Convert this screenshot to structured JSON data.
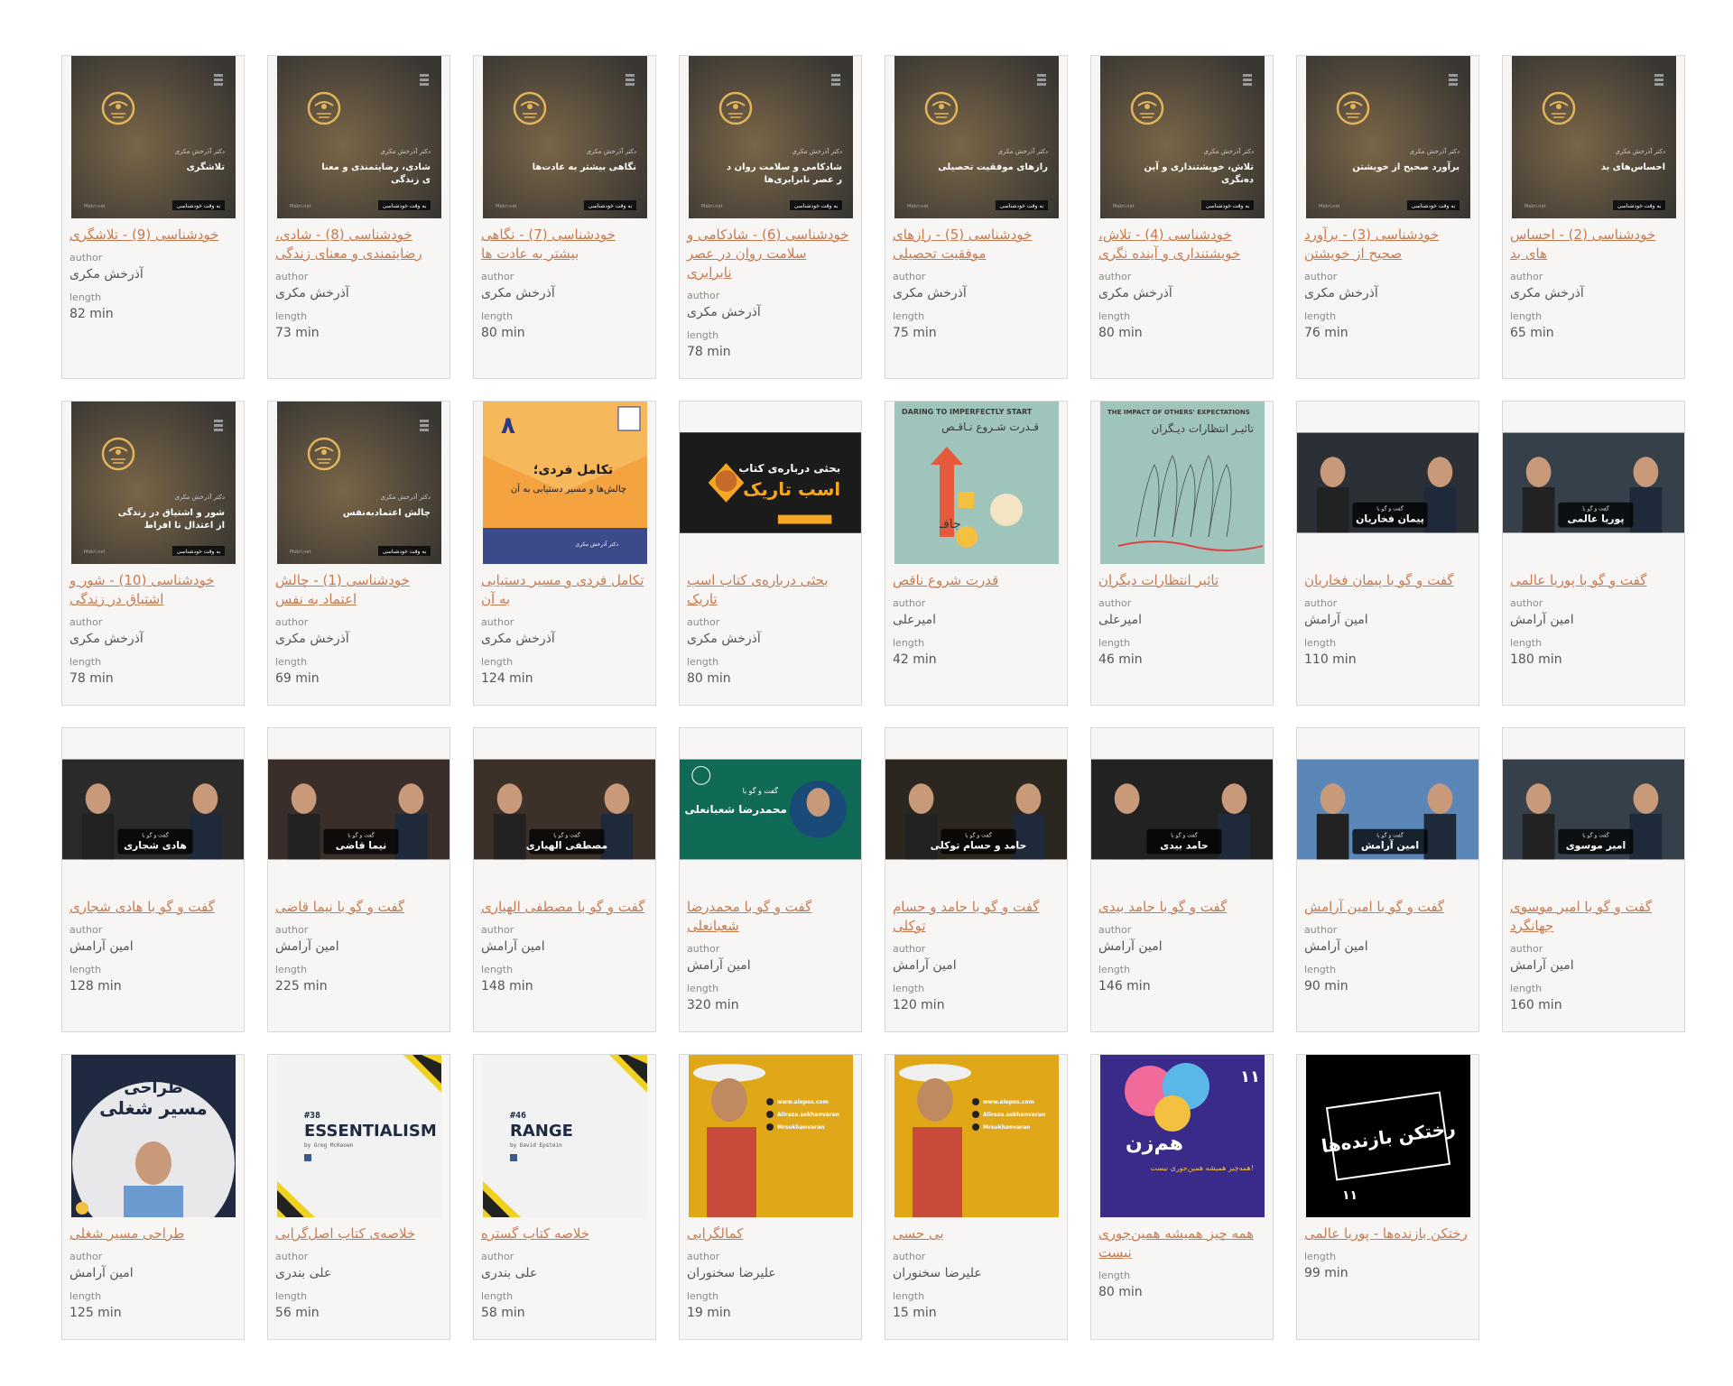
{
  "labels": {
    "author": "author",
    "length": "length"
  },
  "cards": [
    {
      "title": "خودشناسی (9) - تلاشگری",
      "author": "آذرخش مکری",
      "length": "82 min",
      "thumb": {
        "kind": "poster",
        "text": "تلاشگری"
      }
    },
    {
      "title": "خودشناسی (8) - شادی، رضایتمندی و معنای زندگی",
      "author": "آذرخش مکری",
      "length": "73 min",
      "thumb": {
        "kind": "poster",
        "text": "شادی، رضایتمندی و معنای زندگی"
      }
    },
    {
      "title": "خودشناسی (7) - نگاهی بیشتر به عادت ها",
      "author": "آذرخش مکری",
      "length": "80 min",
      "thumb": {
        "kind": "poster",
        "text": "نگاهی بیشتر به عادت‌ها"
      }
    },
    {
      "title": "خودشناسی (6) - شادکامی و سلامت روان در عصر نابرابری",
      "author": "آذرخش مکری",
      "length": "78 min",
      "thumb": {
        "kind": "poster",
        "text": "شادکامی و سلامت روان در عصر نابرابری‌ها"
      }
    },
    {
      "title": "خودشناسی (5) - رازهای موفقیت تحصیلی",
      "author": "آذرخش مکری",
      "length": "75 min",
      "thumb": {
        "kind": "poster",
        "text": "رازهای موفقیت تحصیلی"
      }
    },
    {
      "title": "خودشناسی (4) - تلاش، خویشتنداری و آینده نگری",
      "author": "آذرخش مکری",
      "length": "80 min",
      "thumb": {
        "kind": "poster",
        "text": "تلاش، خویشتنداری و آینده‌نگری"
      }
    },
    {
      "title": "خودشناسی (3) - برآورد صحیح از خویشتن",
      "author": "آذرخش مکری",
      "length": "76 min",
      "thumb": {
        "kind": "poster",
        "text": "برآورد صحیح از خویشتن"
      }
    },
    {
      "title": "خودشناسی (2) - احساس های بد",
      "author": "آذرخش مکری",
      "length": "65 min",
      "thumb": {
        "kind": "poster",
        "text": "احساس‌های بد"
      }
    },
    {
      "title": "خودشناسی (10) - شور و اشتیاق در زندگی",
      "author": "آذرخش مکری",
      "length": "78 min",
      "thumb": {
        "kind": "poster",
        "text": "شور و اشتیاق در زندگی از اعتدال تا افراط"
      }
    },
    {
      "title": "خودشناسی (1) - چالش اعتماد به نفس",
      "author": "آذرخش مکری",
      "length": "69 min",
      "thumb": {
        "kind": "poster",
        "text": "چالش اعتمادبه‌نفس"
      }
    },
    {
      "title": "تکامل فردی و مسیر دستیابی به آن",
      "author": "آذرخش مکری",
      "length": "124 min",
      "thumb": {
        "kind": "orange",
        "text": "تکامل فردی؛ چالش‌ها و مسیر دستیابی به آن"
      }
    },
    {
      "title": "بحثی درباره‌ی کتاب اسب تاریک",
      "author": "آذرخش مکری",
      "length": "80 min",
      "thumb": {
        "kind": "darkhorse",
        "text": "اسب تاریک"
      }
    },
    {
      "title": "قدرت شروع ناقص",
      "author": "امیرعلی",
      "length": "42 min",
      "thumb": {
        "kind": "imperfect",
        "text": "DARING TO IMPERFECTLY START"
      }
    },
    {
      "title": "تاثیر انتظارات دیگران",
      "author": "امیرعلی",
      "length": "46 min",
      "thumb": {
        "kind": "expect",
        "text": "THE IMPACT OF OTHERS' EXPECTATIONS"
      }
    },
    {
      "title": "گفت و گو با پیمان فخاریان",
      "author": "امین آرامش",
      "length": "110 min",
      "thumb": {
        "kind": "interview",
        "text": "پیمان فخاریان",
        "bg": "#2b2f36"
      }
    },
    {
      "title": "گفت و گو با پوریا عالمی",
      "author": "امین آرامش",
      "length": "180 min",
      "thumb": {
        "kind": "interview",
        "text": "پوریا عالمی",
        "bg": "#36404a"
      }
    },
    {
      "title": "گفت و گو با هادی شجاری",
      "author": "امین آرامش",
      "length": "128 min",
      "thumb": {
        "kind": "interview",
        "text": "هادی شجاری",
        "bg": "#2a2a2a"
      }
    },
    {
      "title": "گفت و گو با نیما قاضی",
      "author": "امین آرامش",
      "length": "225 min",
      "thumb": {
        "kind": "interview",
        "text": "نیما قاضی",
        "bg": "#3a2e2a"
      }
    },
    {
      "title": "گفت و گو با مصطفی الهیاری",
      "author": "امین آرامش",
      "length": "148 min",
      "thumb": {
        "kind": "interview",
        "text": "مصطفی الهیاری",
        "bg": "#3b3128"
      }
    },
    {
      "title": "گفت و گو با محمدرضا شعبانعلی",
      "author": "امین آرامش",
      "length": "320 min",
      "thumb": {
        "kind": "green",
        "text": "محمدرضا شعبانعلی"
      }
    },
    {
      "title": "گفت و گو با حامد و حسام توکلی",
      "author": "امین آرامش",
      "length": "120 min",
      "thumb": {
        "kind": "interview",
        "text": "حامد و حسام توکلی",
        "bg": "#2c2620"
      }
    },
    {
      "title": "گفت و گو با حامد بیدی",
      "author": "امین آرامش",
      "length": "146 min",
      "thumb": {
        "kind": "interview",
        "text": "حامد بیدی",
        "bg": "#222222"
      }
    },
    {
      "title": "گفت و گو با امین آرامش",
      "author": "امین آرامش",
      "length": "90 min",
      "thumb": {
        "kind": "interview",
        "text": "امین آرامش",
        "bg": "#5a86b8"
      }
    },
    {
      "title": "گفت و گو با امیر موسوی جهانگرد",
      "author": "امین آرامش",
      "length": "160 min",
      "thumb": {
        "kind": "interview",
        "text": "امیر موسوی",
        "bg": "#36404a"
      }
    },
    {
      "title": "طراحی مسیر شغلی",
      "author": "امین آرامش",
      "length": "125 min",
      "thumb": {
        "kind": "career",
        "text": "طراحی مسیر شغلی"
      }
    },
    {
      "title": "خلاصه‌ی کتاب اصل‌گرایی",
      "author": "علی بندری",
      "length": "56 min",
      "thumb": {
        "kind": "book",
        "text": "ESSENTIALISM",
        "num": "#38",
        "by": "by Greg McKeown"
      }
    },
    {
      "title": "خلاصه کتاب گستره",
      "author": "علی بندری",
      "length": "58 min",
      "thumb": {
        "kind": "book",
        "text": "RANGE",
        "num": "#46",
        "by": "by David Epstein"
      }
    },
    {
      "title": "کمالگرایی",
      "author": "علیرضا سخنوران",
      "length": "19 min",
      "thumb": {
        "kind": "yellow",
        "text": "www.alepos.com"
      }
    },
    {
      "title": "بی حسی",
      "author": "علیرضا سخنوران",
      "length": "15 min",
      "thumb": {
        "kind": "yellow",
        "text": "www.alepos.com"
      }
    },
    {
      "title": "همه چیز همیشه همین‌جوری نیست",
      "author": null,
      "length": "80 min",
      "thumb": {
        "kind": "hamzan",
        "text": "هم‌زن"
      }
    },
    {
      "title": "رختکن بازنده‌ها - پوریا عالمی",
      "author": null,
      "length": "99 min",
      "thumb": {
        "kind": "black",
        "text": "رختکن بازنده‌ها"
      }
    }
  ]
}
